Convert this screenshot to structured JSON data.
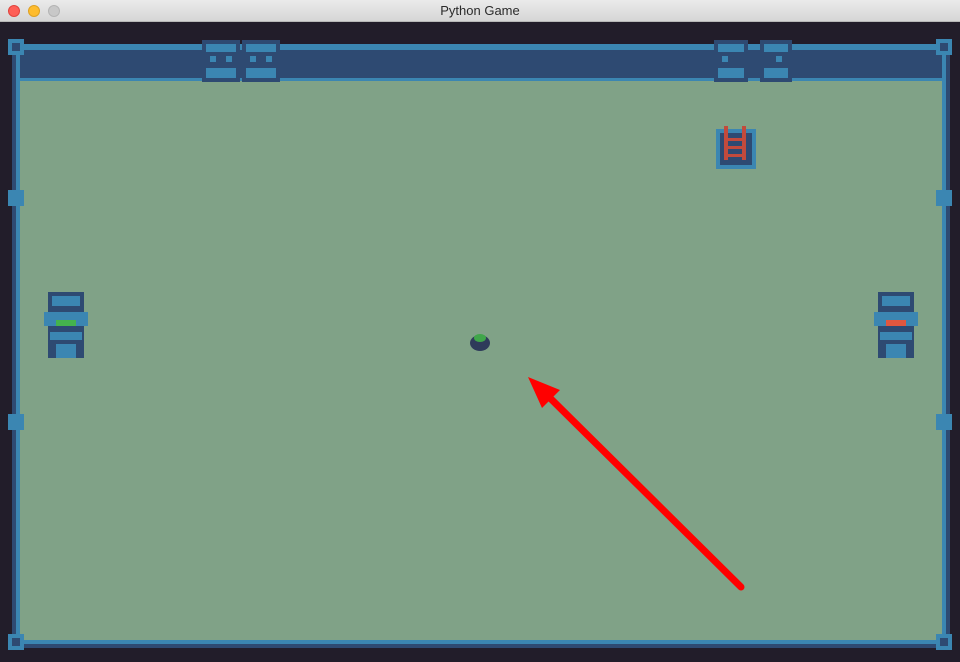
{
  "window": {
    "title": "Python Game",
    "buttons": [
      "close",
      "minimize",
      "maximize"
    ]
  },
  "game": {
    "background_color": "#221d2a",
    "floor_color": "#80a287",
    "wall_color": "#2e4a72",
    "wall_trim_color": "#3b86b2",
    "entities": [
      {
        "name": "player",
        "icon": "slime-icon",
        "color": "#3fa64a"
      },
      {
        "name": "statue-left",
        "icon": "totem-statue-icon",
        "eye_color": "#44b34d"
      },
      {
        "name": "statue-right",
        "icon": "totem-statue-icon",
        "eye_color": "#e0573f"
      },
      {
        "name": "exit-ladder",
        "icon": "ladder-hatch-icon",
        "color": "#c24a3c"
      },
      {
        "name": "wall-statues-top",
        "icon": "wall-statue-icon",
        "count": 4
      }
    ],
    "annotation": {
      "name": "red-arrow",
      "color": "#ff0000"
    }
  }
}
